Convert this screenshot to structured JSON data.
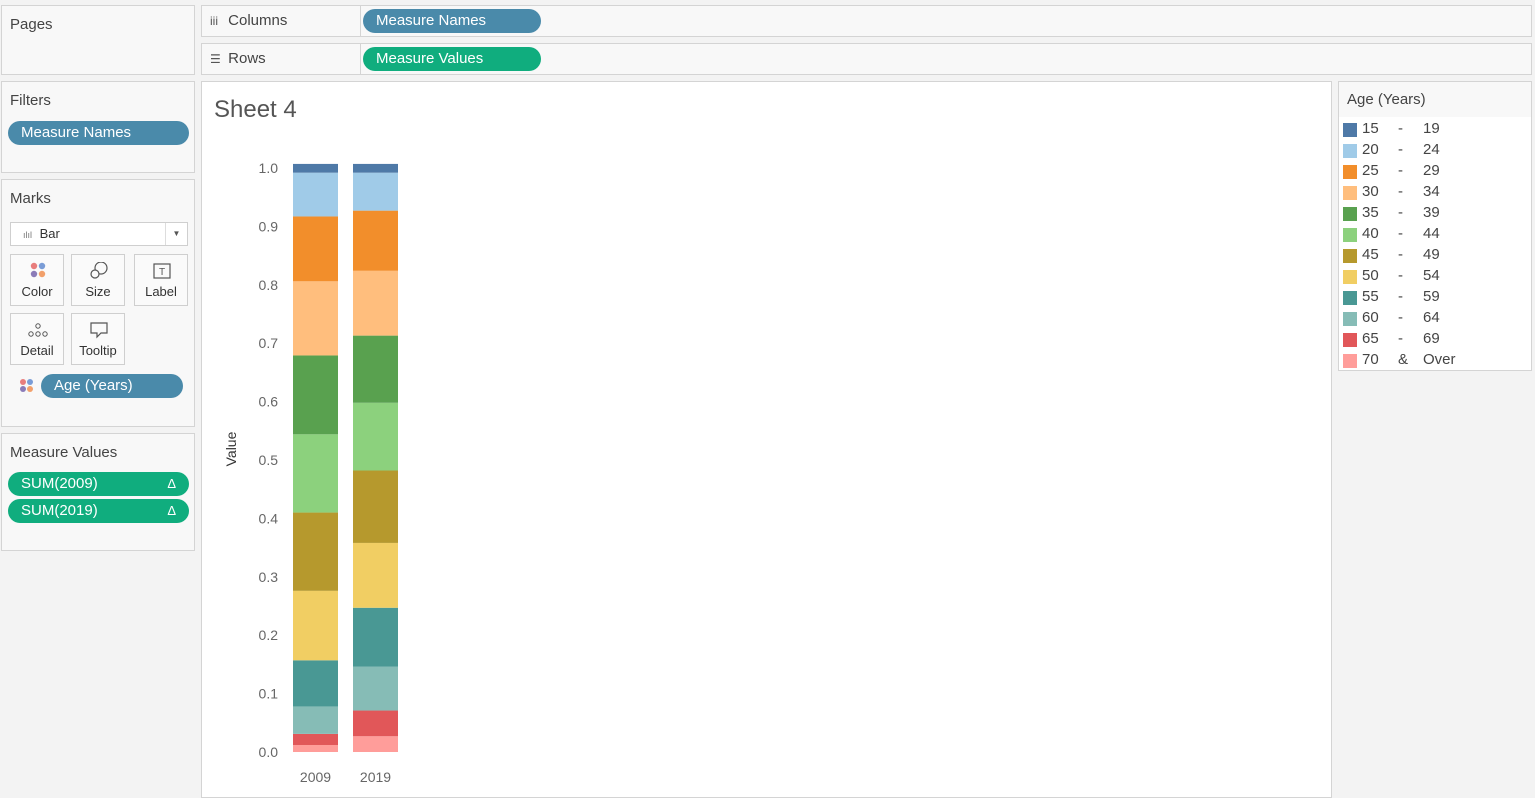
{
  "pages": {
    "title": "Pages"
  },
  "shelves": {
    "columns": {
      "label": "Columns",
      "pill": "Measure Names"
    },
    "rows": {
      "label": "Rows",
      "pill": "Measure Values"
    }
  },
  "filters": {
    "title": "Filters",
    "pill": "Measure Names"
  },
  "marks": {
    "title": "Marks",
    "mark_type": "Bar",
    "buttons": {
      "color": "Color",
      "size": "Size",
      "label": "Label",
      "detail": "Detail",
      "tooltip": "Tooltip"
    },
    "color_pill": "Age (Years)"
  },
  "measure_values": {
    "title": "Measure Values",
    "pills": [
      "SUM(2009)",
      "SUM(2019)"
    ],
    "delta_glyph": "Δ"
  },
  "sheet": {
    "title": "Sheet 4"
  },
  "legend": {
    "title": "Age (Years)",
    "items": [
      {
        "a": "15",
        "b": "-",
        "c": "19",
        "color": "#4e79a7"
      },
      {
        "a": "20",
        "b": "-",
        "c": "24",
        "color": "#a0cbe8"
      },
      {
        "a": "25",
        "b": "-",
        "c": "29",
        "color": "#f28e2b"
      },
      {
        "a": "30",
        "b": "-",
        "c": "34",
        "color": "#ffbe7d"
      },
      {
        "a": "35",
        "b": "-",
        "c": "39",
        "color": "#59a14f"
      },
      {
        "a": "40",
        "b": "-",
        "c": "44",
        "color": "#8cd17d"
      },
      {
        "a": "45",
        "b": "-",
        "c": "49",
        "color": "#b6992d"
      },
      {
        "a": "50",
        "b": "-",
        "c": "54",
        "color": "#f1ce63"
      },
      {
        "a": "55",
        "b": "-",
        "c": "59",
        "color": "#499894"
      },
      {
        "a": "60",
        "b": "-",
        "c": "64",
        "color": "#86bcb6"
      },
      {
        "a": "65",
        "b": "-",
        "c": "69",
        "color": "#e15759"
      },
      {
        "a": "70",
        "b": "&",
        "c": "Over",
        "color": "#ff9d9a"
      }
    ]
  },
  "chart_data": {
    "type": "bar",
    "stacked": true,
    "categories": [
      "2009",
      "2019"
    ],
    "ylabel": "Value",
    "ylim": [
      0,
      1.0
    ],
    "yticks": [
      "0.0",
      "0.1",
      "0.2",
      "0.3",
      "0.4",
      "0.5",
      "0.6",
      "0.7",
      "0.8",
      "0.9",
      "1.0"
    ],
    "series": [
      {
        "name": "70 & Over",
        "values": [
          0.012,
          0.027
        ]
      },
      {
        "name": "65 - 69",
        "values": [
          0.019,
          0.044
        ]
      },
      {
        "name": "60 - 64",
        "values": [
          0.047,
          0.075
        ]
      },
      {
        "name": "55 - 59",
        "values": [
          0.079,
          0.101
        ]
      },
      {
        "name": "50 - 54",
        "values": [
          0.119,
          0.111
        ]
      },
      {
        "name": "45 - 49",
        "values": [
          0.134,
          0.124
        ]
      },
      {
        "name": "40 - 44",
        "values": [
          0.134,
          0.116
        ]
      },
      {
        "name": "35 - 39",
        "values": [
          0.135,
          0.115
        ]
      },
      {
        "name": "30 - 34",
        "values": [
          0.127,
          0.111
        ]
      },
      {
        "name": "25 - 29",
        "values": [
          0.111,
          0.103
        ]
      },
      {
        "name": "20 - 24",
        "values": [
          0.075,
          0.065
        ]
      },
      {
        "name": "15 - 19",
        "values": [
          0.015,
          0.015
        ]
      }
    ]
  }
}
